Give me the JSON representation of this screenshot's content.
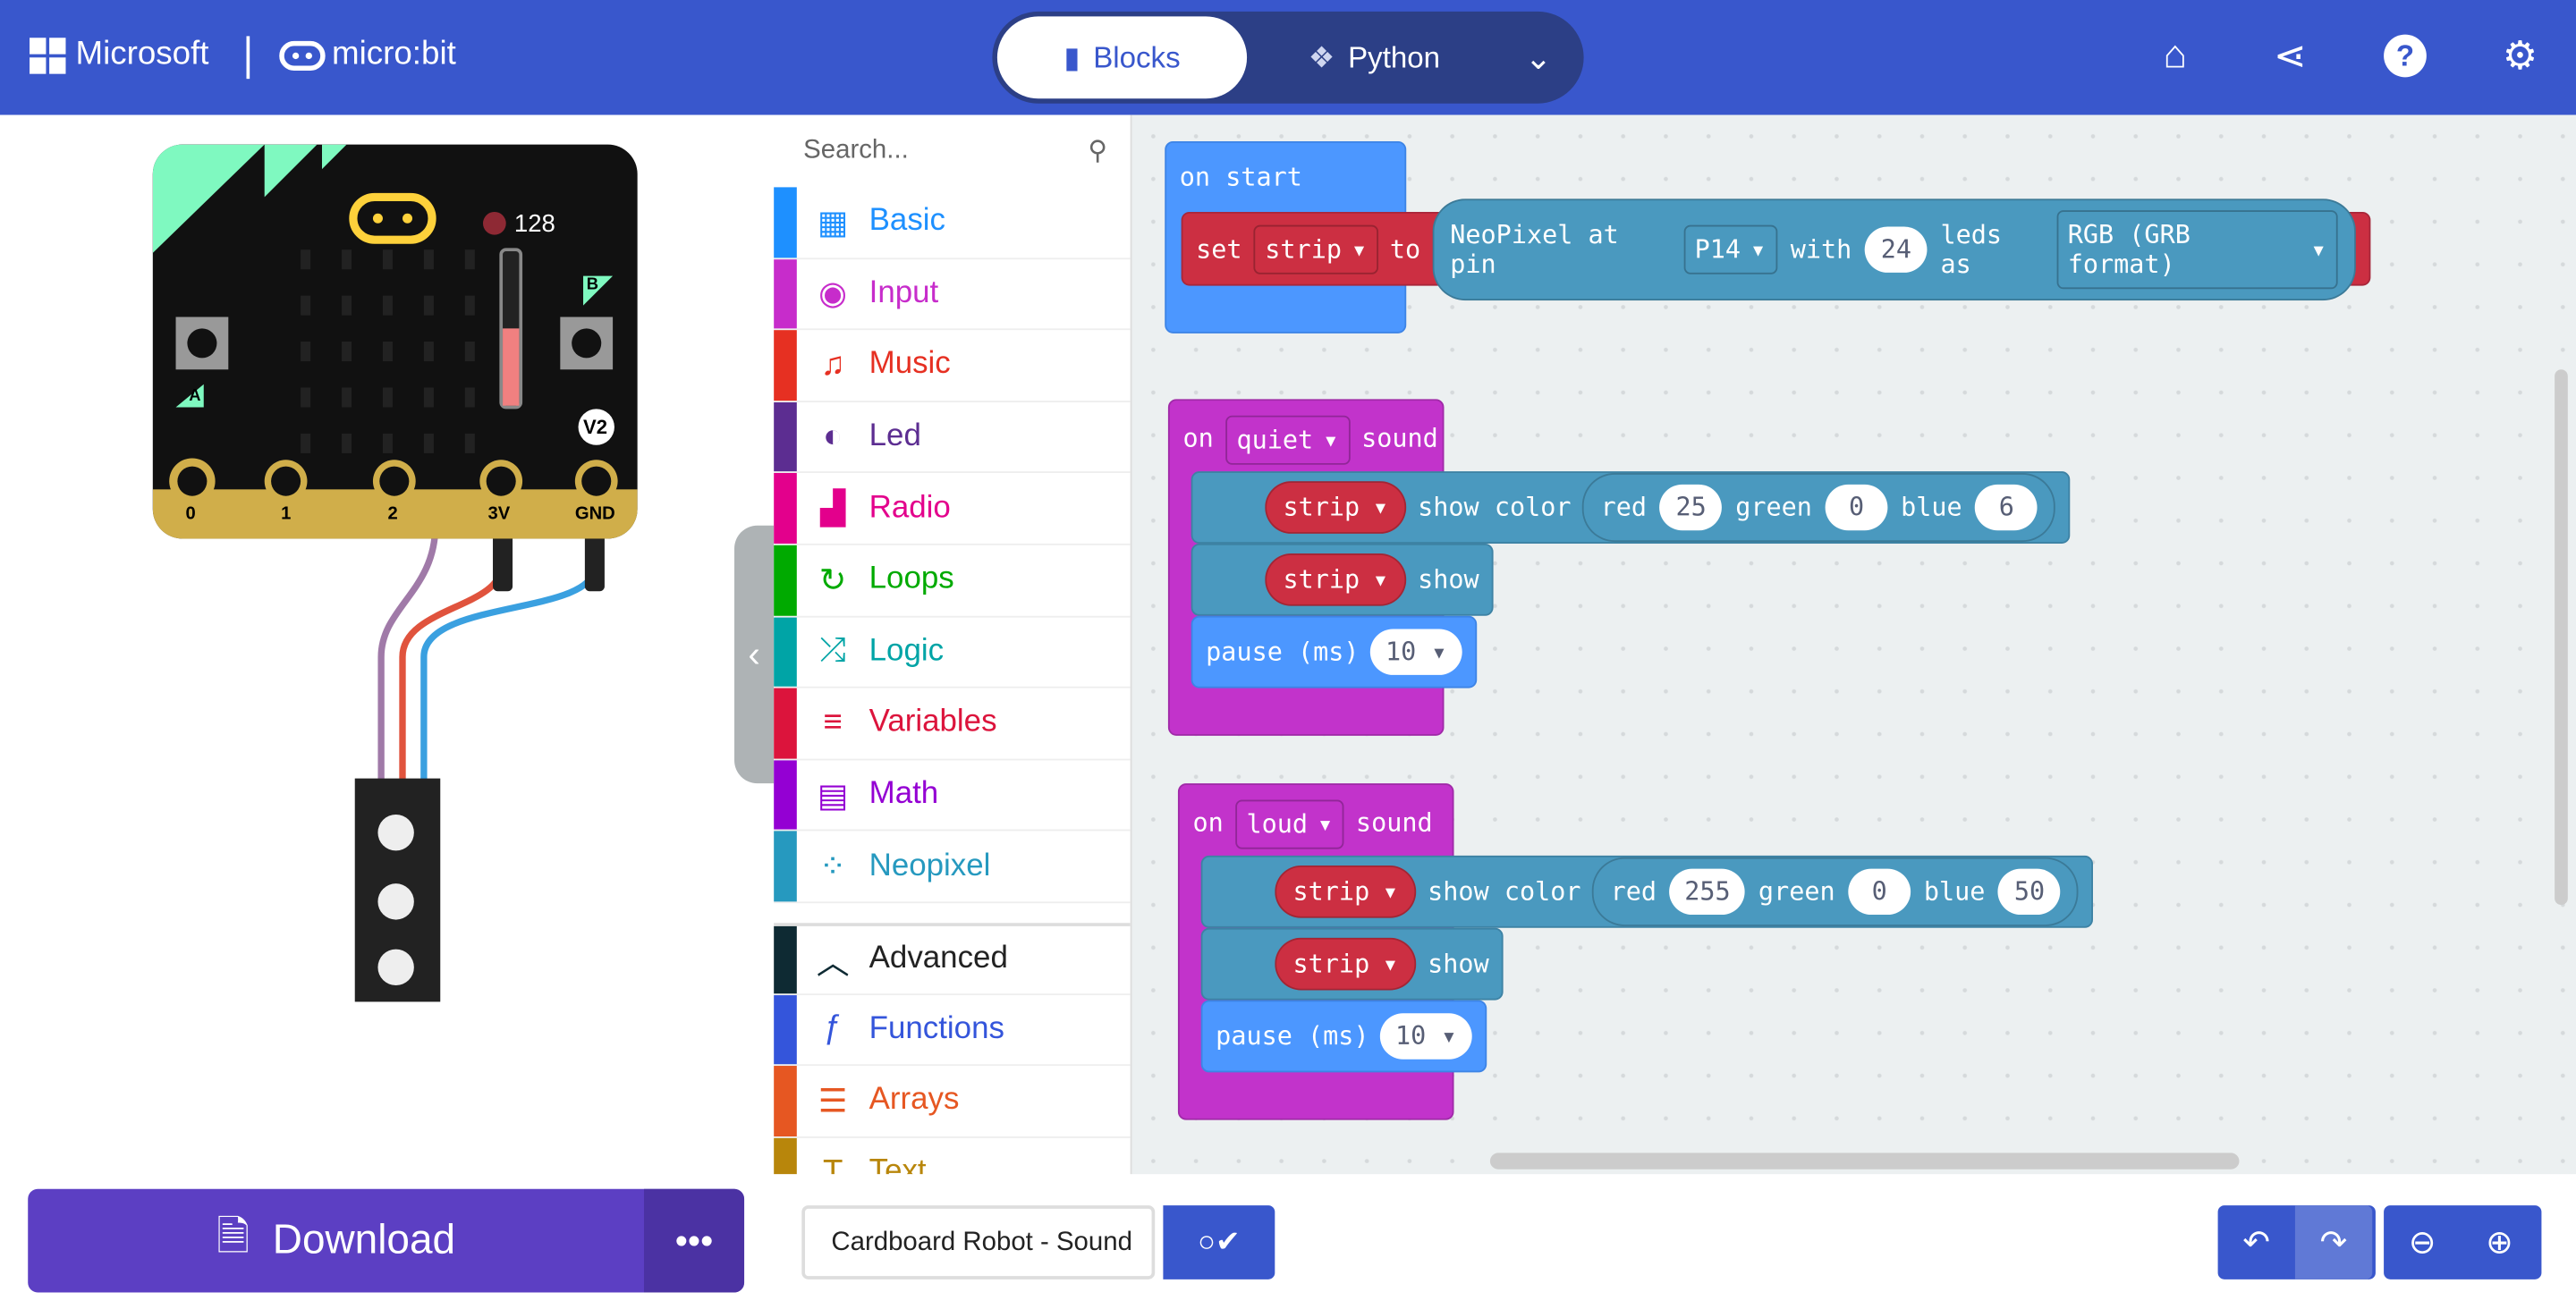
{
  "header": {
    "brand": "Microsoft",
    "product": "micro:bit",
    "modes": [
      {
        "label": "Blocks",
        "icon": "puzzle-icon",
        "active": true
      },
      {
        "label": "Python",
        "icon": "python-icon",
        "active": false
      }
    ],
    "icons": [
      "home-icon",
      "share-icon",
      "help-icon",
      "gear-icon"
    ],
    "color": "#3957cc"
  },
  "simulator": {
    "sound_level": "128",
    "pins": [
      "0",
      "1",
      "2",
      "3V",
      "GND"
    ],
    "buttons": [
      "A",
      "B"
    ],
    "version": "V2",
    "sound_bar_percent": 50
  },
  "toolbox": {
    "search_placeholder": "Search...",
    "categories": [
      {
        "label": "Basic",
        "color": "#1e90ff",
        "icon": "grid-icon"
      },
      {
        "label": "Input",
        "color": "#c72ccb",
        "icon": "target-icon"
      },
      {
        "label": "Music",
        "color": "#e63022",
        "icon": "headphones-icon"
      },
      {
        "label": "Led",
        "color": "#5c2d91",
        "icon": "toggle-icon"
      },
      {
        "label": "Radio",
        "color": "#e3008c",
        "icon": "signal-icon"
      },
      {
        "label": "Loops",
        "color": "#00aa00",
        "icon": "refresh-icon"
      },
      {
        "label": "Logic",
        "color": "#00a4a6",
        "icon": "shuffle-icon"
      },
      {
        "label": "Variables",
        "color": "#dc143c",
        "icon": "list-icon"
      },
      {
        "label": "Math",
        "color": "#9400d3",
        "icon": "calculator-icon"
      },
      {
        "label": "Neopixel",
        "color": "#2699bf",
        "icon": "dots-circle-icon"
      },
      {
        "label": "Advanced",
        "color": "#0e2a33",
        "icon": "chevron-up-icon"
      },
      {
        "label": "Functions",
        "color": "#3455db",
        "icon": "function-icon"
      },
      {
        "label": "Arrays",
        "color": "#e65722",
        "icon": "numbered-list-icon"
      },
      {
        "label": "Text",
        "color": "#b8860b",
        "icon": "text-icon"
      }
    ]
  },
  "blocks": {
    "on_start": {
      "label": "on start",
      "set": "set",
      "var": "strip",
      "to": "to",
      "neo": "NeoPixel at pin",
      "pin": "P14",
      "with": "with",
      "leds": "24",
      "leds_as": "leds as",
      "format": "RGB (GRB format)"
    },
    "quiet": {
      "on": "on",
      "event": "quiet",
      "sound": "sound",
      "show_color": "show color",
      "red": "red",
      "red_val": "25",
      "green": "green",
      "green_val": "0",
      "blue": "blue",
      "blue_val": "6",
      "show": "show",
      "pause": "pause (ms)",
      "pause_val": "10",
      "var": "strip"
    },
    "loud": {
      "on": "on",
      "event": "loud",
      "sound": "sound",
      "show_color": "show color",
      "red": "red",
      "red_val": "255",
      "green": "green",
      "green_val": "0",
      "blue": "blue",
      "blue_val": "50",
      "show": "show",
      "pause": "pause (ms)",
      "pause_val": "10",
      "var": "strip"
    }
  },
  "bottom": {
    "download": "Download",
    "more": "•••",
    "project_name": "Cardboard Robot - Sound"
  }
}
